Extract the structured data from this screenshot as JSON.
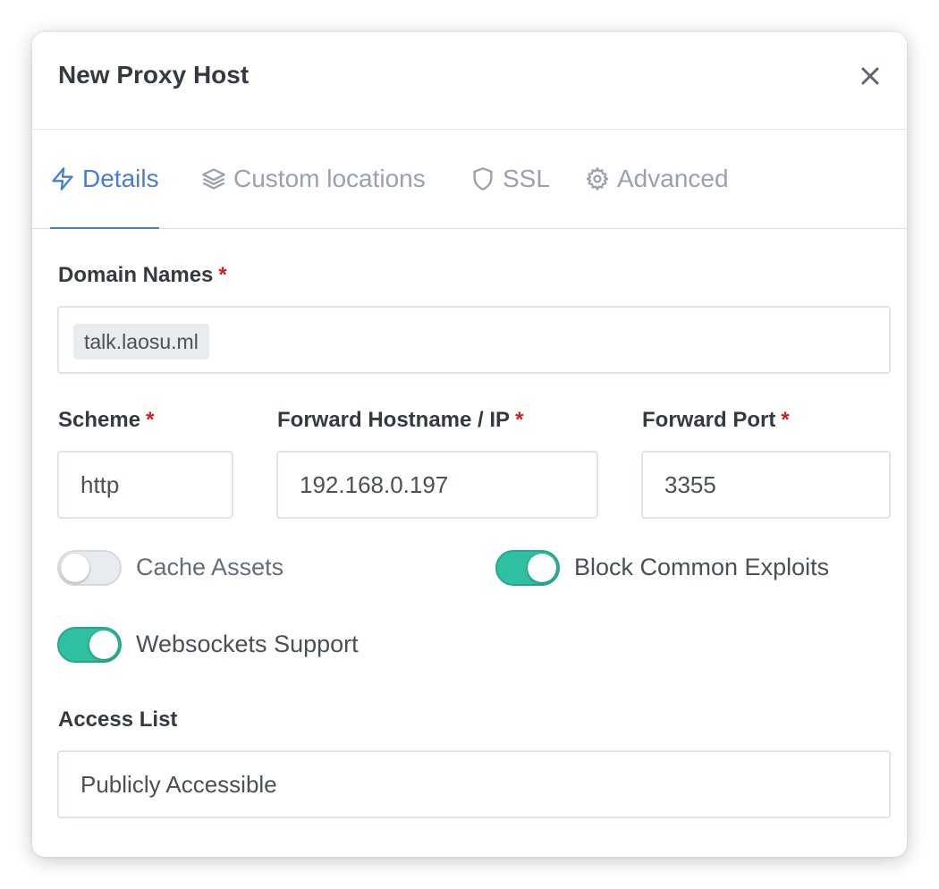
{
  "modal": {
    "title": "New Proxy Host",
    "close_icon": "close-icon"
  },
  "tabs": [
    {
      "label": "Details",
      "icon": "lightning-icon",
      "active": true
    },
    {
      "label": "Custom locations",
      "icon": "layers-icon",
      "active": false
    },
    {
      "label": "SSL",
      "icon": "shield-icon",
      "active": false
    },
    {
      "label": "Advanced",
      "icon": "gear-icon",
      "active": false
    }
  ],
  "form": {
    "domain_names": {
      "label": "Domain Names",
      "required": "*",
      "values": [
        "talk.laosu.ml"
      ]
    },
    "scheme": {
      "label": "Scheme",
      "required": "*",
      "value": "http"
    },
    "forward_host": {
      "label": "Forward Hostname / IP",
      "required": "*",
      "value": "192.168.0.197"
    },
    "forward_port": {
      "label": "Forward Port",
      "required": "*",
      "value": "3355"
    },
    "toggles": {
      "cache_assets": {
        "label": "Cache Assets",
        "enabled": false
      },
      "block_exploits": {
        "label": "Block Common Exploits",
        "enabled": true
      },
      "websockets": {
        "label": "Websockets Support",
        "enabled": true
      }
    },
    "access_list": {
      "label": "Access List",
      "value": "Publicly Accessible"
    }
  },
  "colors": {
    "accent": "#467fcf",
    "toggle_on": "#2fbfa1",
    "required": "#cd201f"
  }
}
